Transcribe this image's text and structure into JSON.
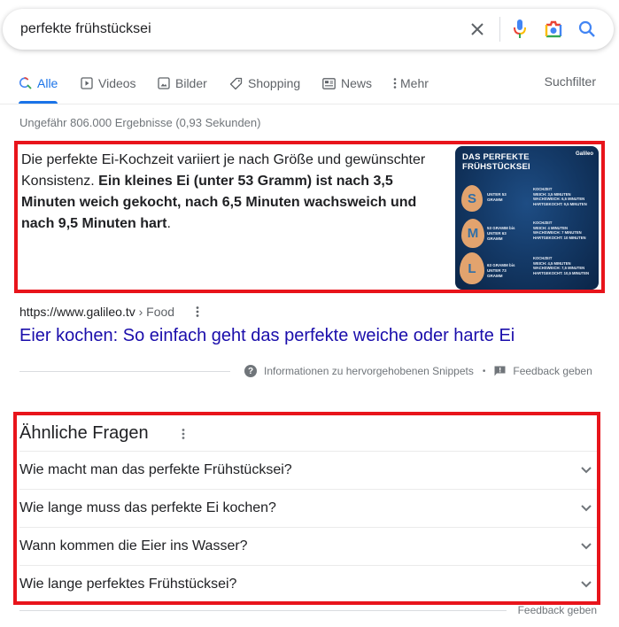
{
  "search": {
    "query": "perfekte frühstücksei",
    "icons": [
      "close-icon",
      "microphone-icon",
      "camera-lens-icon",
      "search-icon"
    ]
  },
  "tabs": [
    {
      "label": "Alle",
      "icon": "search-icon",
      "active": true
    },
    {
      "label": "Videos",
      "icon": "video-icon",
      "active": false
    },
    {
      "label": "Bilder",
      "icon": "image-icon",
      "active": false
    },
    {
      "label": "Shopping",
      "icon": "tag-icon",
      "active": false
    },
    {
      "label": "News",
      "icon": "news-icon",
      "active": false
    },
    {
      "label": "Mehr",
      "icon": "more-vert-icon",
      "active": false
    }
  ],
  "suchfilter_label": "Suchfilter",
  "result_stats": "Ungefähr 806.000 Ergebnisse (0,93 Sekunden)",
  "colors": {
    "accent_blue": "#1a73e8",
    "link_color": "#1a0dab",
    "highlight_border": "#e8141b"
  },
  "featured_snippet": {
    "text_plain": "Die perfekte Ei-Kochzeit variiert je nach Größe und gewünschter Konsistenz. ",
    "text_bold": "Ein kleines Ei (unter 53 Gramm) ist nach 3,5 Minuten weich gekocht, nach 6,5 Minuten wachsweich und nach 9,5 Minuten hart",
    "text_end": ".",
    "image": {
      "title_line1": "DAS PERFEKTE",
      "title_line2": "FRÜHSTÜCKSEI",
      "brand": "Galileo",
      "sizes": [
        {
          "letter": "S",
          "label": "UNTER 53 GRAMM",
          "times": [
            "KOCHZEIT",
            "WEICH: 3,5 MINUTEN",
            "WACHSWEICH: 6,5 MINUTEN",
            "HARTGEKOCHT: 9,5 MINUTEN"
          ]
        },
        {
          "letter": "M",
          "label": "53 GRAMM bis UNTER 63 GRAMM",
          "times": [
            "KOCHZEIT",
            "WEICH: 4 MINUTEN",
            "WACHSWEICH: 7 MINUTEN",
            "HARTGEKOCHT: 10 MINUTEN"
          ]
        },
        {
          "letter": "L",
          "label": "63 GRAMM bis UNTER 73 GRAMM",
          "times": [
            "KOCHZEIT",
            "WEICH: 4,5 MINUTEN",
            "WACHSWEICH: 7,5 MINUTEN",
            "HARTGEKOCHT: 10,5 MINUTEN"
          ]
        }
      ]
    },
    "source_url": "https://www.galileo.tv",
    "source_crumb": " › Food",
    "result_title": "Eier kochen: So einfach geht das perfekte weiche oder harte Ei",
    "footer_info": "Informationen zu hervorgehobenen Snippets",
    "footer_separator": "•",
    "footer_feedback": "Feedback geben"
  },
  "related_questions": {
    "title": "Ähnliche Fragen",
    "items": [
      "Wie macht man das perfekte Frühstücksei?",
      "Wie lange muss das perfekte Ei kochen?",
      "Wann kommen die Eier ins Wasser?",
      "Wie lange perfektes Frühstücksei?"
    ],
    "feedback": "Feedback geben"
  }
}
